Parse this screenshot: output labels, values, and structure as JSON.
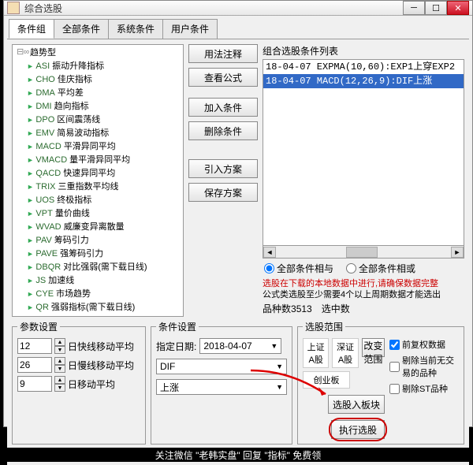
{
  "window": {
    "title": "综合选股"
  },
  "tabs": [
    "条件组",
    "全部条件",
    "系统条件",
    "用户条件"
  ],
  "tree": {
    "root": "趋势型",
    "items": [
      {
        "k": "ASI",
        "t": "振动升降指标"
      },
      {
        "k": "CHO",
        "t": "佳庆指标"
      },
      {
        "k": "DMA",
        "t": "平均差"
      },
      {
        "k": "DMI",
        "t": "趋向指标"
      },
      {
        "k": "DPO",
        "t": "区间震荡线"
      },
      {
        "k": "EMV",
        "t": "简易波动指标"
      },
      {
        "k": "MACD",
        "t": "平滑异同平均"
      },
      {
        "k": "VMACD",
        "t": "量平滑异同平均"
      },
      {
        "k": "QACD",
        "t": "快速异同平均"
      },
      {
        "k": "TRIX",
        "t": "三重指数平均线"
      },
      {
        "k": "UOS",
        "t": "终极指标"
      },
      {
        "k": "VPT",
        "t": "量价曲线"
      },
      {
        "k": "WVAD",
        "t": "威廉变异离散量"
      },
      {
        "k": "PAV",
        "t": "筹码引力"
      },
      {
        "k": "PAVE",
        "t": "强筹码引力"
      },
      {
        "k": "DBQR",
        "t": "对比强弱(需下载日线)"
      },
      {
        "k": "JS",
        "t": "加速线"
      },
      {
        "k": "CYE",
        "t": "市场趋势"
      },
      {
        "k": "QR",
        "t": "强弱指标(需下载日线)"
      }
    ]
  },
  "sidebuttons": {
    "usage": "用法注释",
    "viewformula": "查看公式",
    "addcond": "加入条件",
    "delcond": "删除条件",
    "importplan": "引入方案",
    "saveplan": "保存方案"
  },
  "condlist": {
    "label": "组合选股条件列表",
    "rows": [
      "18-04-07 EXPMA(10,60):EXP1上穿EXP2",
      "18-04-07 MACD(12,26,9):DIF上涨"
    ]
  },
  "radios": {
    "and": "全部条件相与",
    "or": "全部条件相或"
  },
  "warn": "选股在下载的本地数据中进行,请确保数据完整",
  "note": "公式类选股至少需要4个以上周期数据才能选出",
  "counts": {
    "total_label": "品种数",
    "total": "3513",
    "sel_label": "选中数",
    "sel": ""
  },
  "params": {
    "legend": "参数设置",
    "rows": [
      {
        "v": "12",
        "l": "日快线移动平均"
      },
      {
        "v": "26",
        "l": "日慢线移动平均"
      },
      {
        "v": "9",
        "l": "日移动平均"
      }
    ]
  },
  "condset": {
    "legend": "条件设置",
    "date_label": "指定日期:",
    "date": "2018-04-07",
    "combo1": "DIF",
    "combo2": "上涨"
  },
  "scope": {
    "legend": "选股范围",
    "items": [
      "上证A股",
      "深证A股",
      "创业板"
    ],
    "change": "改变范围",
    "checks": {
      "preadj": "前复权数据",
      "excl_curr": "剔除当前无交易的品种",
      "excl_st": "剔除ST品种"
    },
    "addblock": "选股入板块",
    "exec": "执行选股"
  },
  "banner": {
    "t1": "关注微信",
    "t2": "\"老韩实盘\"",
    "t3": "回复",
    "t4": "\"指标\"",
    "t5": "免费领"
  }
}
